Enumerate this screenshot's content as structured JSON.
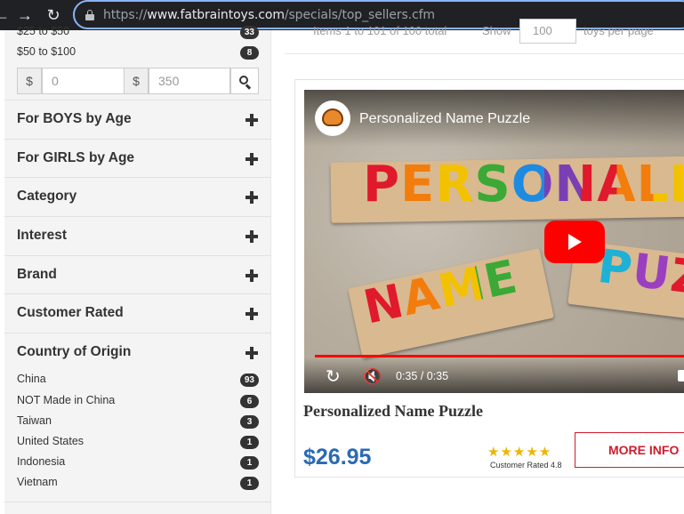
{
  "browser": {
    "url_prefix": "https://",
    "url_host": "www.fatbraintoys.com",
    "url_path": "/specials/top_sellers.cfm"
  },
  "sidebar": {
    "price_ranges": [
      {
        "label": "$25 to $50",
        "count": "33"
      },
      {
        "label": "$50 to $100",
        "count": "8"
      }
    ],
    "price_filter": {
      "currency_symbol": "$",
      "min_placeholder": "0",
      "max_placeholder": "350"
    },
    "filters": [
      {
        "label": "For BOYS by Age"
      },
      {
        "label": "For GIRLS by Age"
      },
      {
        "label": "Category"
      },
      {
        "label": "Interest"
      },
      {
        "label": "Brand"
      },
      {
        "label": "Customer Rated"
      },
      {
        "label": "Country of Origin"
      }
    ],
    "country_of_origin": [
      {
        "label": "China",
        "count": "93"
      },
      {
        "label": "NOT Made in China",
        "count": "6"
      },
      {
        "label": "Taiwan",
        "count": "3"
      },
      {
        "label": "United States",
        "count": "1"
      },
      {
        "label": "Indonesia",
        "count": "1"
      },
      {
        "label": "Vietnam",
        "count": "1"
      }
    ]
  },
  "toolbar": {
    "items_text": "Items 1 to 101 of 100 total",
    "show_label": "Show",
    "show_value": "100",
    "per_page_label": "toys per page"
  },
  "product": {
    "video": {
      "title": "Personalized Name Puzzle",
      "puzzle_word_1": "PERSONALIZ",
      "puzzle_word_2": "NAME",
      "puzzle_word_3": "PUZ",
      "time": "0:35 / 0:35"
    },
    "name": "Personalized Name Puzzle",
    "price": "$26.95",
    "stars": "★★★★★",
    "rating_text": "Customer Rated 4.8",
    "more_info_label": "MORE INFO"
  }
}
